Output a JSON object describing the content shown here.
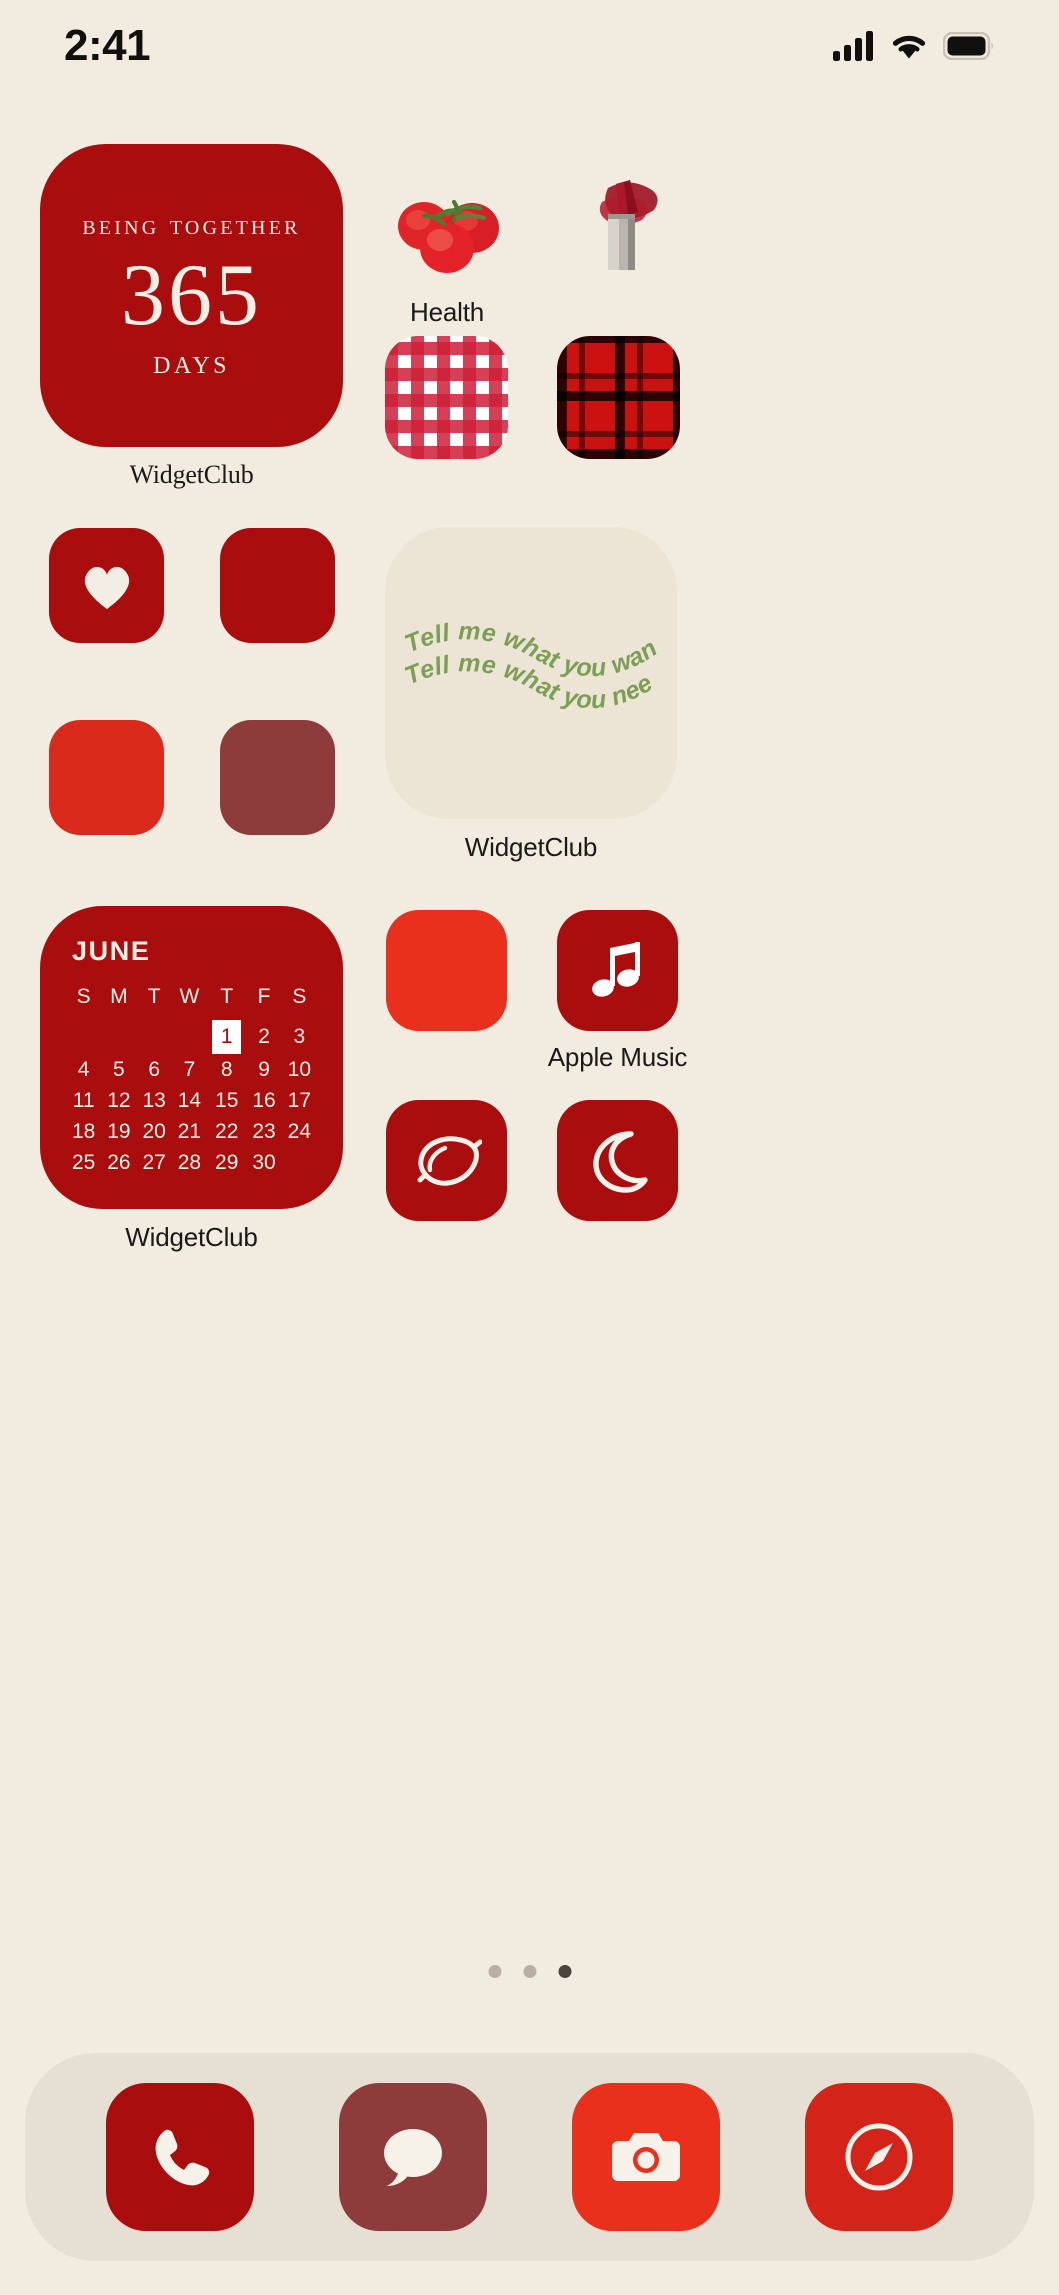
{
  "status_bar": {
    "time": "2:41",
    "signal_icon": "cellular-signal-icon",
    "wifi_icon": "wifi-icon",
    "battery_icon": "battery-full-icon"
  },
  "theme": {
    "background": "#f1ebe0",
    "primary_red": "#a90d0d",
    "bright_red": "#e8301c",
    "muted_red": "#8e3b3b",
    "cream": "#ece5d6",
    "text_dark": "#1c1a18",
    "quote_green": "#7d9e55"
  },
  "widgets": {
    "anniversary": {
      "title": "Being together",
      "count": "365",
      "unit": "Days",
      "label": "WidgetClub"
    },
    "quote": {
      "line1": "Tell me what you want,",
      "line2": "Tell me what you need",
      "label": "WidgetClub"
    },
    "calendar": {
      "month": "JUNE",
      "label": "WidgetClub",
      "weekdays": [
        "S",
        "M",
        "T",
        "W",
        "T",
        "F",
        "S"
      ],
      "today": "1",
      "weeks": [
        [
          "",
          "",
          "",
          "",
          "1",
          "2",
          "3"
        ],
        [
          "4",
          "5",
          "6",
          "7",
          "8",
          "9",
          "10"
        ],
        [
          "11",
          "12",
          "13",
          "14",
          "15",
          "16",
          "17"
        ],
        [
          "18",
          "19",
          "20",
          "21",
          "22",
          "23",
          "24"
        ],
        [
          "25",
          "26",
          "27",
          "28",
          "29",
          "30",
          ""
        ]
      ]
    }
  },
  "apps": {
    "health": {
      "label": "Health",
      "icon": "tomatoes-icon"
    },
    "lipstick": {
      "label": "",
      "icon": "lipstick-icon"
    },
    "gingham": {
      "label": "",
      "icon": "gingham-pattern-icon"
    },
    "plaid": {
      "label": "",
      "icon": "plaid-pattern-icon"
    },
    "heart": {
      "label": "",
      "icon": "heart-icon"
    },
    "blank_dark_red": {
      "label": "",
      "icon": "blank-tile-icon"
    },
    "blank_bright_red": {
      "label": "",
      "icon": "blank-tile-icon"
    },
    "blank_muted_red": {
      "label": "",
      "icon": "blank-tile-icon"
    },
    "blank_scarlet": {
      "label": "",
      "icon": "blank-tile-icon"
    },
    "apple_music": {
      "label": "Apple Music",
      "icon": "music-note-icon"
    },
    "lemon": {
      "label": "",
      "icon": "lemon-icon"
    },
    "moon": {
      "label": "",
      "icon": "crescent-moon-icon"
    }
  },
  "dock": {
    "items": [
      {
        "name": "phone",
        "label": "",
        "icon": "phone-icon",
        "color": "#a90d0d"
      },
      {
        "name": "messages",
        "label": "",
        "icon": "message-bubble-icon",
        "color": "#8e3b3b"
      },
      {
        "name": "camera",
        "label": "",
        "icon": "camera-icon",
        "color": "#e8301c"
      },
      {
        "name": "safari",
        "label": "",
        "icon": "compass-icon",
        "color": "#d42319"
      }
    ]
  },
  "page_indicator": {
    "total": 3,
    "active_index": 3
  }
}
